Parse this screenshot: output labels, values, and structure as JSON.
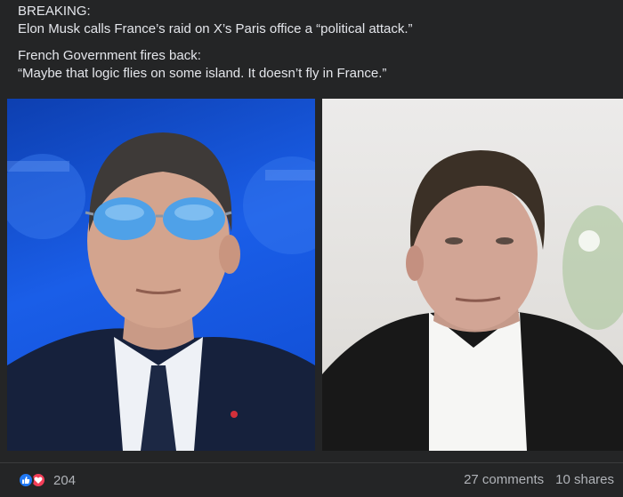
{
  "post": {
    "line1": "BREAKING:",
    "line2": "Elon Musk calls France’s raid on X’s Paris office a “political attack.”",
    "line3": "French Government fires back:",
    "line4": "“Maybe that logic flies on some island. It doesn’t fly in France.”"
  },
  "photos": [
    {
      "subject": "man-in-blue-sunglasses",
      "background": "#1a5ee8"
    },
    {
      "subject": "man-in-dark-suit",
      "background": "#e6e4e1"
    }
  ],
  "footer": {
    "reaction_icons": [
      "like-icon",
      "love-icon"
    ],
    "reaction_count": "204",
    "comments": "27 comments",
    "shares": "10 shares"
  },
  "colors": {
    "background": "#242526",
    "text": "#e4e6eb",
    "muted": "#b0b3b8",
    "like": "#2078f4",
    "love": "#f33e58"
  }
}
